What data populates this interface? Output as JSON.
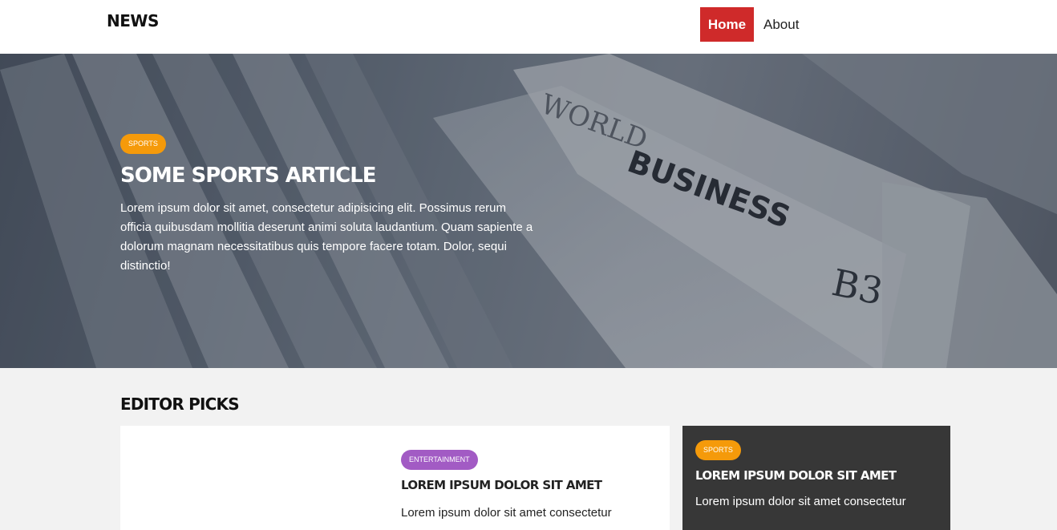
{
  "header": {
    "logo": "NEWS",
    "nav": {
      "home": "Home",
      "about": "About"
    }
  },
  "hero": {
    "badge": "SPORTS",
    "title": "SOME SPORTS ARTICLE",
    "text": "Lorem ipsum dolor sit amet, consectetur adipisicing elit. Possimus rerum officia quibusdam mollitia deserunt animi soluta laudantium. Quam sapiente a dolorum magnam necessitatibus quis tempore facere totam. Dolor, sequi distinctio!",
    "image_text": {
      "line1": "WORLD",
      "line2": "BUSINESS",
      "line3": "B3"
    }
  },
  "editor_picks": {
    "title": "EDITOR PICKS",
    "main_card": {
      "badge": "ENTERTAINMENT",
      "title": "LOREM IPSUM DOLOR SIT AMET",
      "text": "Lorem ipsum dolor sit amet consectetur"
    },
    "side_card": {
      "badge": "SPORTS",
      "title": "LOREM IPSUM DOLOR SIT AMET",
      "text": "Lorem ipsum dolor sit amet consectetur"
    }
  },
  "colors": {
    "accent_red": "#cf2a2a",
    "badge_orange": "#f59a0a",
    "badge_purple": "#a25bc4",
    "dark_card": "#373737",
    "section_bg": "#f2f2f2"
  }
}
